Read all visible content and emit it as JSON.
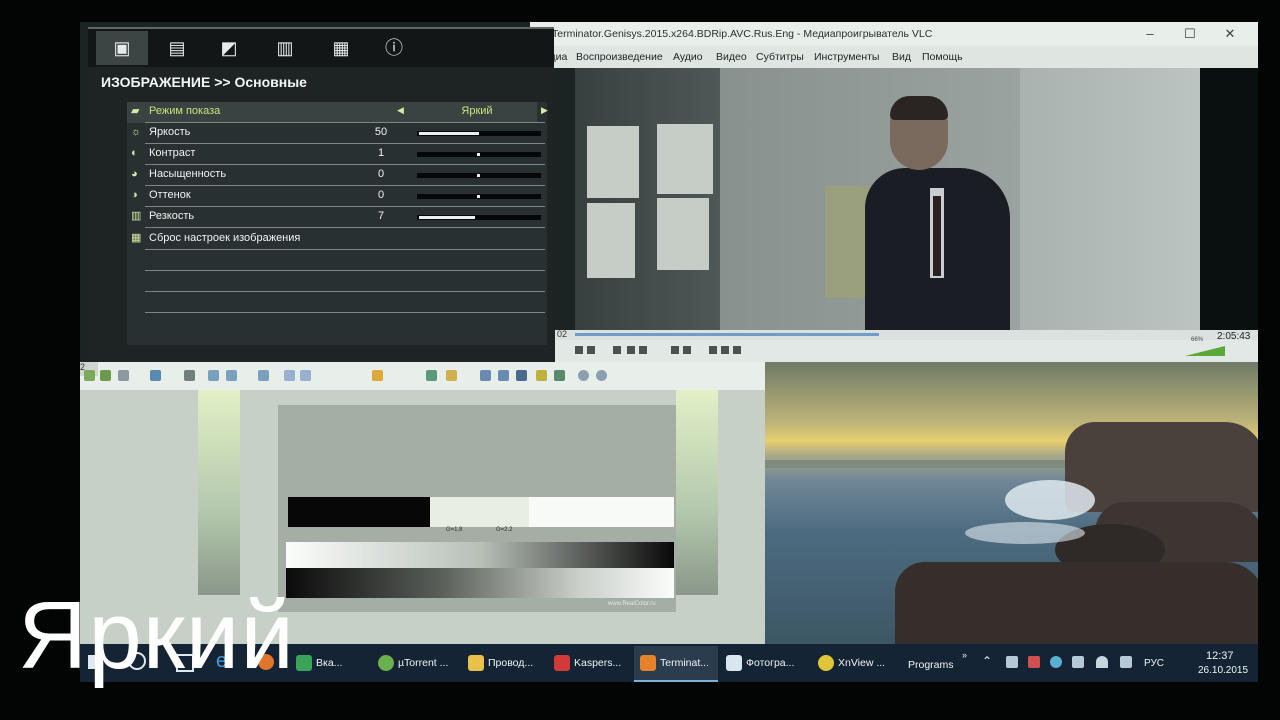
{
  "vlc": {
    "title": "Terminator.Genisys.2015.x264.BDRip.AVC.Rus.Eng - Медиапроигрыватель VLC",
    "menu": [
      "Медиа",
      "Воспроизведение",
      "Аудио",
      "Видео",
      "Субтитры",
      "Инструменты",
      "Вид",
      "Помощь"
    ],
    "time_elapsed": "02",
    "time_total": "2:05:43",
    "progress": 0.44,
    "volume_label": "66%"
  },
  "osd": {
    "header": "ИЗОБРАЖЕНИЕ >> Основные",
    "tab_icons": [
      "play-icon",
      "picture-icon",
      "image-adjust-icon",
      "document-icon",
      "documents-icon",
      "info-icon"
    ],
    "rows": [
      {
        "label": "Режим показа",
        "value": "Яркий",
        "kind": "select",
        "icon": "mode-icon"
      },
      {
        "label": "Яркость",
        "value": "50",
        "level": 0.5,
        "kind": "fill",
        "icon": "sun-icon"
      },
      {
        "label": "Контраст",
        "value": "1",
        "level": 0.5,
        "kind": "dot",
        "icon": "contrast-icon"
      },
      {
        "label": "Насыщенность",
        "value": "0",
        "level": 0.5,
        "kind": "dot",
        "icon": "saturation-icon"
      },
      {
        "label": "Оттенок",
        "value": "0",
        "level": 0.5,
        "kind": "dot",
        "icon": "hue-icon"
      },
      {
        "label": "Резкость",
        "value": "7",
        "level": 0.47,
        "kind": "fill",
        "icon": "sharpness-icon"
      },
      {
        "label": "Сброс настроек изображения",
        "kind": "action",
        "icon": "reset-icon"
      }
    ]
  },
  "viewer": {
    "tab_label": "2",
    "gamma_labels": [
      "G=1.8",
      "G=2.2"
    ],
    "credit": "www.RealColor.ru"
  },
  "taskbar": {
    "tasks": [
      {
        "label": "Вка...",
        "color": "#3aa35a"
      },
      {
        "label": "µTorrent ...",
        "color": "#6ab04c"
      },
      {
        "label": "Провод...",
        "color": "#e8c04a"
      },
      {
        "label": "Kaspers...",
        "color": "#d23a3a"
      },
      {
        "label": "Terminat...",
        "color": "#e6822a"
      },
      {
        "label": "Фотогра...",
        "color": "#d9e6ef"
      },
      {
        "label": "XnView ...",
        "color": "#e0c43a"
      }
    ],
    "programs_label": "Programs",
    "language": "РУС",
    "time": "12:37",
    "date": "26.10.2015"
  },
  "caption": "Яркий"
}
